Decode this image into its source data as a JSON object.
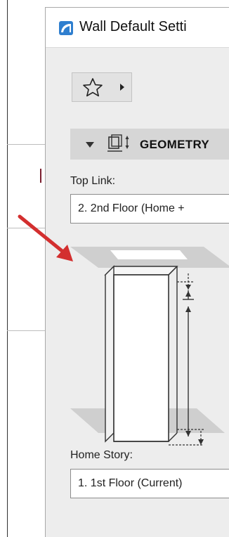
{
  "dialog": {
    "title": "Wall Default Setti",
    "section_title": "GEOMETRY",
    "top_link_label": "Top Link:",
    "top_link_value": "2. 2nd Floor (Home +",
    "home_story_label": "Home Story:",
    "home_story_value": "1. 1st Floor (Current)"
  },
  "icons": {
    "app": "archicad-icon",
    "favorites": "star-icon",
    "favorites_caret": "caret-right-icon",
    "collapse": "triangle-down-icon",
    "geometry": "wall-height-icon",
    "annotation": "red-arrow-icon"
  },
  "colors": {
    "accent_arrow": "#d32f2f",
    "app_icon": "#2f7fcf",
    "section_bg": "#d6d6d6",
    "dialog_bg": "#ededed"
  }
}
